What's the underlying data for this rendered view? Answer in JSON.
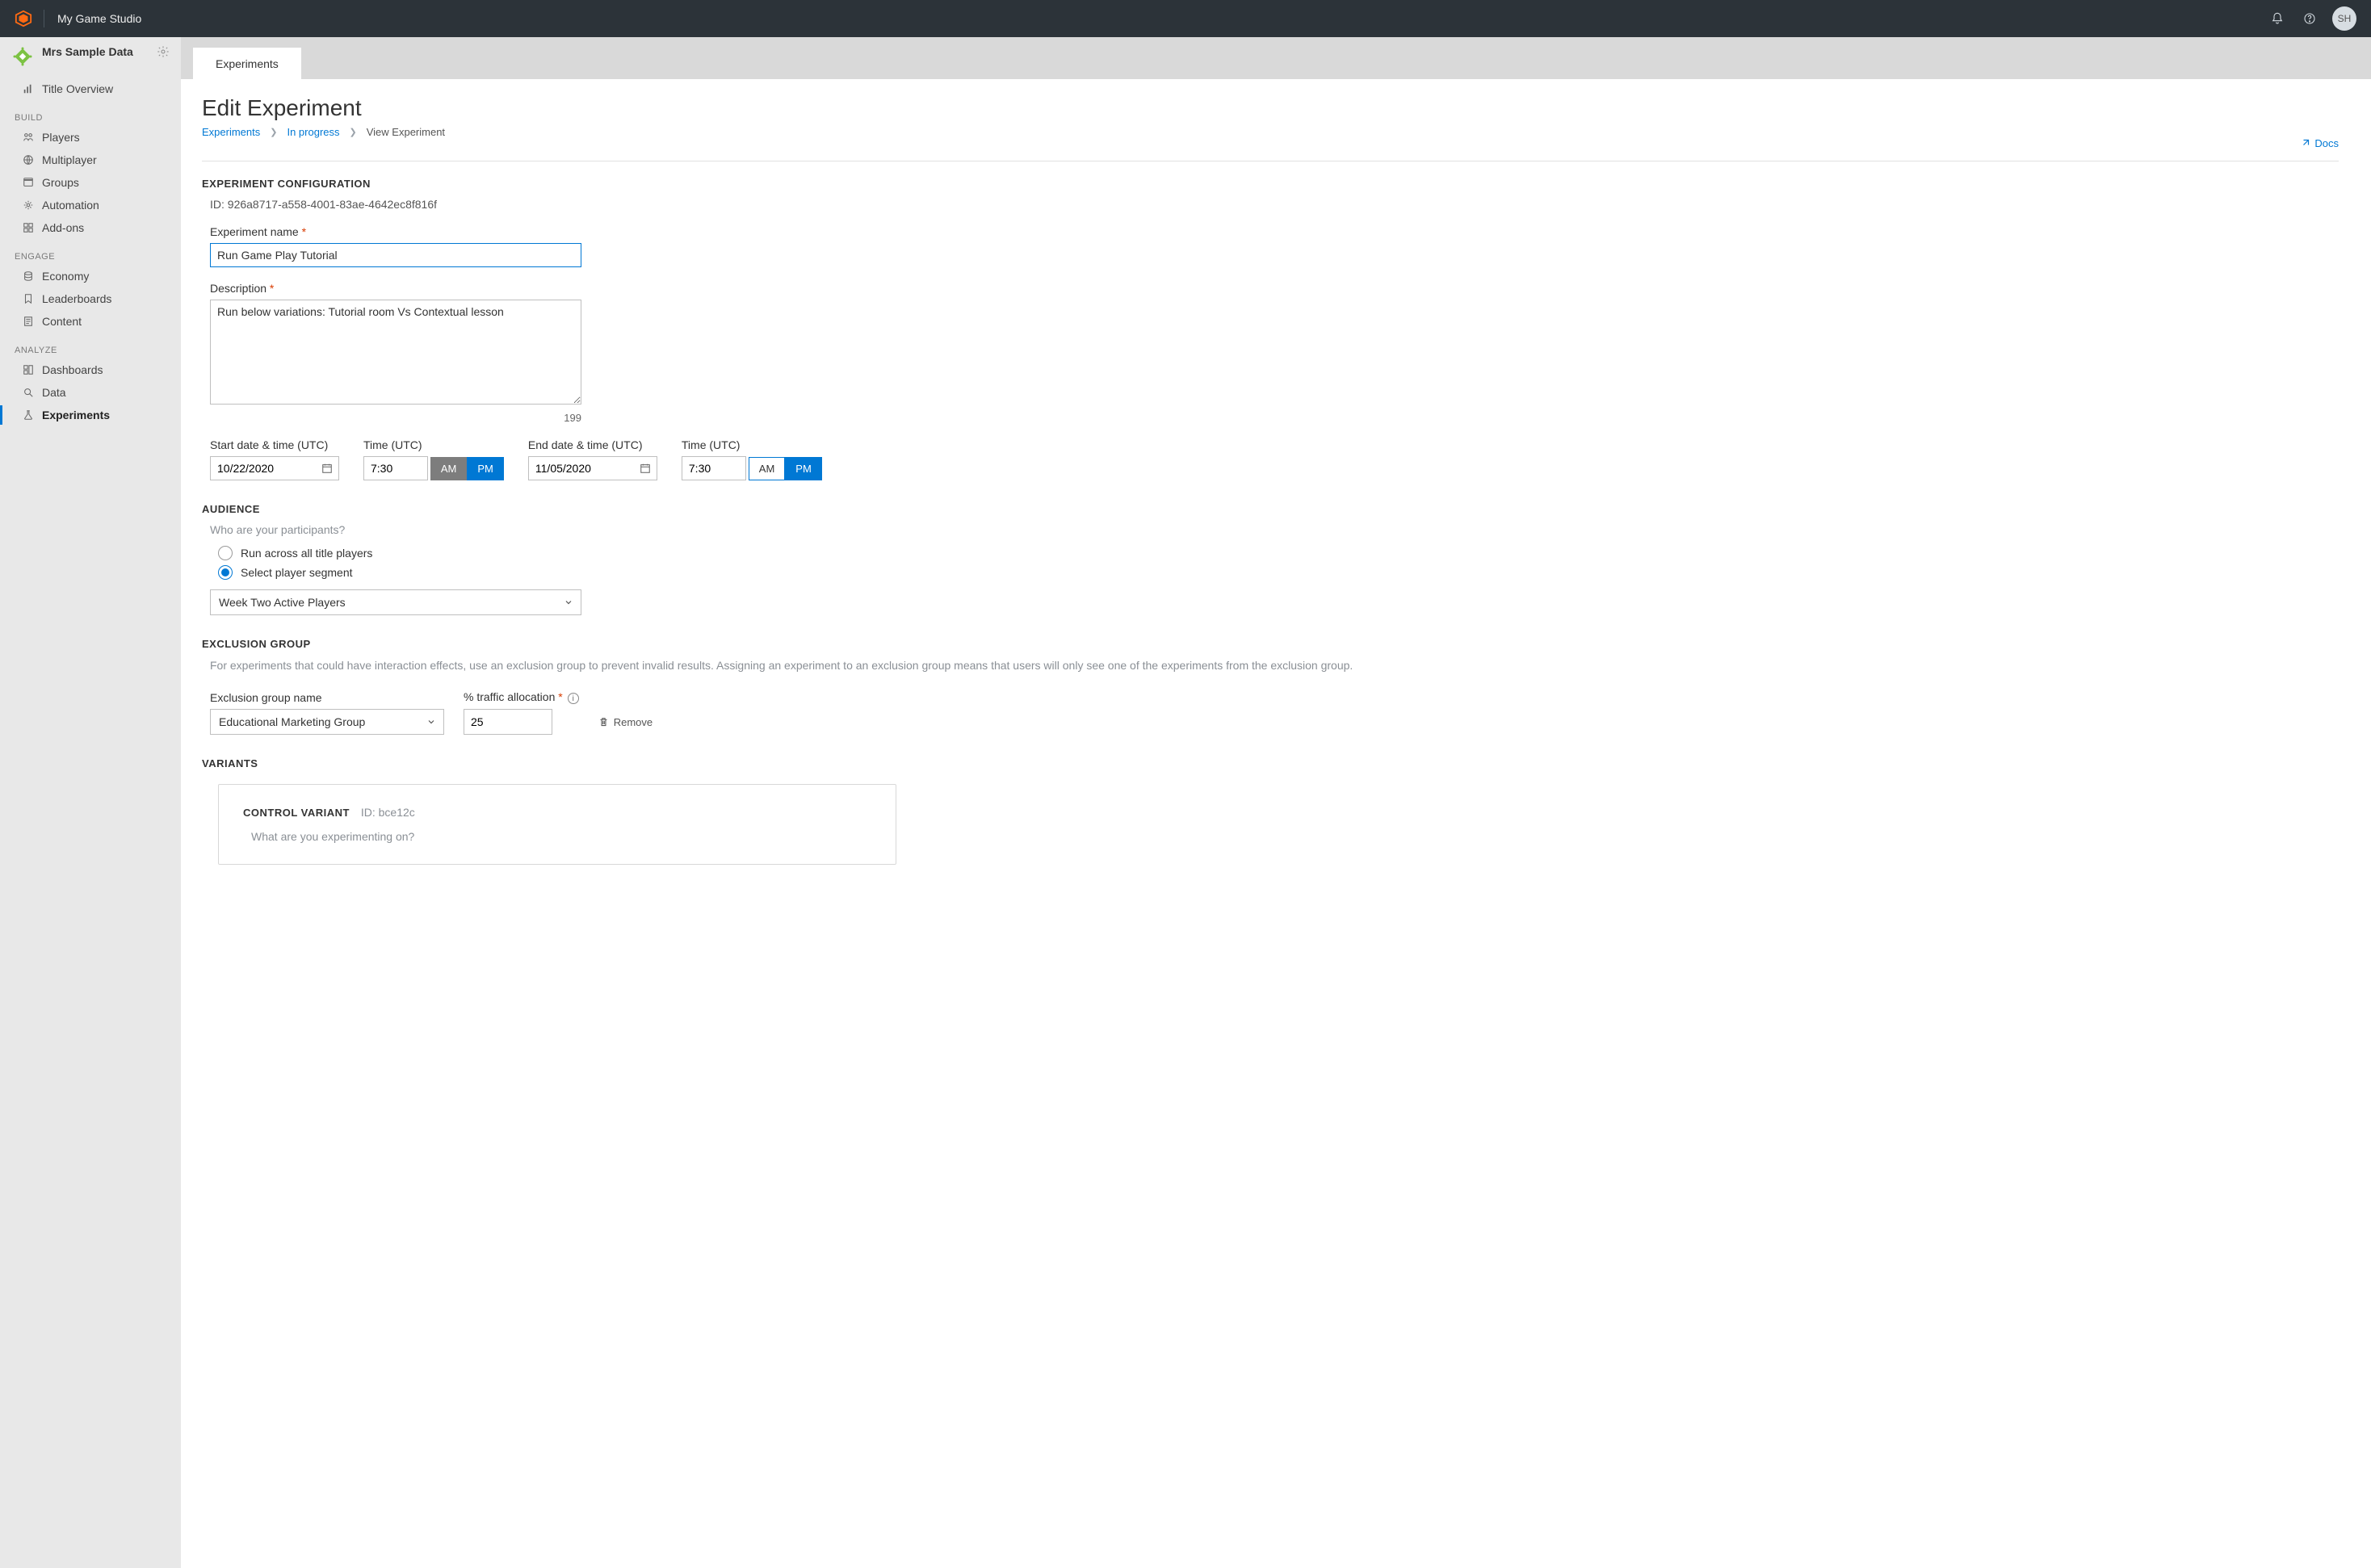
{
  "topbar": {
    "studio_name": "My Game Studio",
    "avatar_initials": "SH"
  },
  "sidebar": {
    "app_title": "Mrs Sample Data",
    "overview": "Title Overview",
    "groups": {
      "build": {
        "label": "BUILD",
        "items": [
          "Players",
          "Multiplayer",
          "Groups",
          "Automation",
          "Add-ons"
        ]
      },
      "engage": {
        "label": "ENGAGE",
        "items": [
          "Economy",
          "Leaderboards",
          "Content"
        ]
      },
      "analyze": {
        "label": "ANALYZE",
        "items": [
          "Dashboards",
          "Data",
          "Experiments"
        ]
      }
    }
  },
  "tabs": {
    "experiments": "Experiments"
  },
  "page": {
    "title": "Edit Experiment",
    "breadcrumb": {
      "a": "Experiments",
      "b": "In progress",
      "c": "View Experiment"
    },
    "docs": "Docs"
  },
  "config": {
    "heading": "EXPERIMENT CONFIGURATION",
    "id_label": "ID:",
    "id_value": "926a8717-a558-4001-83ae-4642ec8f816f",
    "name_label": "Experiment name",
    "name_value": "Run Game Play Tutorial",
    "desc_label": "Description",
    "desc_value": "Run below variations: Tutorial room Vs Contextual lesson",
    "desc_counter": "199",
    "start_label": "Start date & time (UTC)",
    "start_value": "10/22/2020",
    "end_label": "End date & time (UTC)",
    "end_value": "11/05/2020",
    "time_label": "Time (UTC)",
    "start_time": "7:30",
    "end_time": "7:30",
    "am": "AM",
    "pm": "PM"
  },
  "audience": {
    "heading": "AUDIENCE",
    "sub": "Who are your participants?",
    "opt_all": "Run across all title players",
    "opt_segment": "Select player segment",
    "segment_value": "Week Two Active Players"
  },
  "exclusion": {
    "heading": "EXCLUSION GROUP",
    "desc": "For experiments that could have interaction effects, use an exclusion group to prevent invalid results. Assigning an experiment to an exclusion group means that users will only see one of the experiments from the exclusion group.",
    "name_label": "Exclusion group name",
    "name_value": "Educational Marketing Group",
    "traffic_label": "% traffic allocation",
    "traffic_value": "25",
    "remove": "Remove"
  },
  "variants": {
    "heading": "VARIANTS",
    "control_heading": "CONTROL VARIANT",
    "control_id_label": "ID:",
    "control_id": "bce12c",
    "question": "What are you experimenting on?"
  }
}
